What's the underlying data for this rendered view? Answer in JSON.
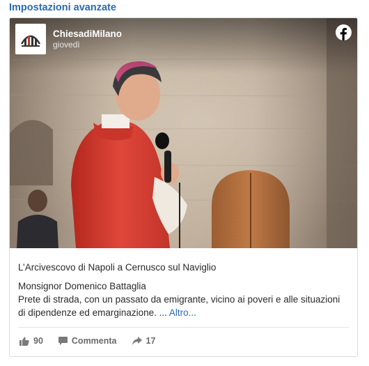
{
  "advanced_settings_label": "Impostazioni avanzate",
  "post": {
    "page_name": "ChiesadiMilano",
    "day": "giovedì",
    "logo_icon": "chiesa-di-milano-logo-icon",
    "network_icon": "facebook-icon",
    "headline": "L’Arcivescovo di Napoli a Cernusco sul Naviglio",
    "author": "Monsignor Domenico Battaglia",
    "description": "Prete di strada, con un passato da emigrante, vicino ai poveri e alle situazioni di dipendenze ed emarginazione. ...",
    "more_label": "Altro...",
    "likes": "90",
    "comment_label": "Commenta",
    "shares": "17"
  },
  "colors": {
    "link": "#2a6bb4",
    "vestment": "#d2362a",
    "facebook_white": "#ffffff"
  }
}
